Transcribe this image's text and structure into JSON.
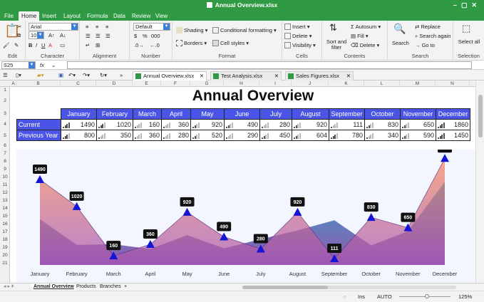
{
  "window": {
    "title": "Annual Overview.xlsx"
  },
  "menu": [
    "File",
    "Home",
    "Insert",
    "Layout",
    "Formula",
    "Data",
    "Review",
    "View"
  ],
  "ribbon": {
    "font_name": "Arial",
    "font_size": "10",
    "number_format": "Default",
    "groups": [
      "Edit",
      "Character",
      "Alignment",
      "Number",
      "Format",
      "Cells",
      "Contents",
      "Search",
      "Selection"
    ],
    "format": {
      "shading": "Shading",
      "conditional": "Conditional formatting",
      "borders": "Borders",
      "cell_styles": "Cell styles"
    },
    "cells": {
      "insert": "Insert",
      "delete": "Delete",
      "visibility": "Visibility"
    },
    "contents": {
      "sort_filter": "Sort and filter",
      "autosum": "Autosum",
      "fill": "Fill",
      "delete": "Delete"
    },
    "search": {
      "search": "Search",
      "replace": "Replace",
      "search_again": "Search again",
      "go_to": "Go to"
    },
    "selection": {
      "select_all": "Select all"
    }
  },
  "formula_bar": {
    "cell_ref": "S25",
    "fx": "fx",
    "value": ""
  },
  "doc_tabs": [
    "Annual Overview.xlsx",
    "Test Analysis.xlsx",
    "Sales Figures.xlsx"
  ],
  "columns": [
    "A",
    "B",
    "C",
    "D",
    "E",
    "F",
    "G",
    "H",
    "I",
    "J",
    "K",
    "L",
    "M",
    "N"
  ],
  "rows": [
    "1",
    "2",
    "3",
    "4",
    "5",
    "6",
    "7",
    "8",
    "9",
    "10",
    "11",
    "12",
    "13",
    "14",
    "15",
    "16",
    "17",
    "18",
    "19",
    "20",
    "21"
  ],
  "sheet_title": "Annual Overview",
  "table": {
    "headers": [
      "January",
      "February",
      "March",
      "April",
      "May",
      "June",
      "July",
      "August",
      "September",
      "October",
      "November",
      "December"
    ],
    "rows": [
      {
        "label": "Current",
        "values": [
          "1490",
          "1020",
          "160",
          "360",
          "920",
          "490",
          "280",
          "920",
          "111",
          "830",
          "650",
          "1860"
        ]
      },
      {
        "label": "Previous Year",
        "values": [
          "800",
          "350",
          "360",
          "280",
          "520",
          "290",
          "450",
          "604",
          "780",
          "340",
          "590",
          "1450"
        ]
      }
    ]
  },
  "chart_data": {
    "type": "area",
    "categories": [
      "January",
      "February",
      "March",
      "April",
      "May",
      "June",
      "July",
      "August",
      "September",
      "October",
      "November",
      "December"
    ],
    "series": [
      {
        "name": "Current",
        "values": [
          1490,
          1020,
          160,
          360,
          920,
          490,
          280,
          920,
          111,
          830,
          650,
          1860
        ]
      },
      {
        "name": "Previous Year",
        "values": [
          800,
          350,
          360,
          280,
          520,
          290,
          450,
          604,
          780,
          340,
          590,
          1450
        ]
      }
    ],
    "data_labels": [
      "1490",
      "1020",
      "160",
      "360",
      "920",
      "490",
      "280",
      "920",
      "111",
      "830",
      "650",
      "1860"
    ],
    "ylim": [
      0,
      1900
    ]
  },
  "sheet_tabs": [
    "Annual Overview",
    "Products",
    "Branches",
    "+"
  ],
  "status": {
    "mode": "Ins",
    "lang": "AUTO",
    "zoom": "125%"
  },
  "colors": {
    "accent": "#2f9a43",
    "header_fill": "#4a55e8",
    "area_current": "#f07a5a",
    "area_previous": "#1e84b8",
    "marker": "#1414d4"
  }
}
